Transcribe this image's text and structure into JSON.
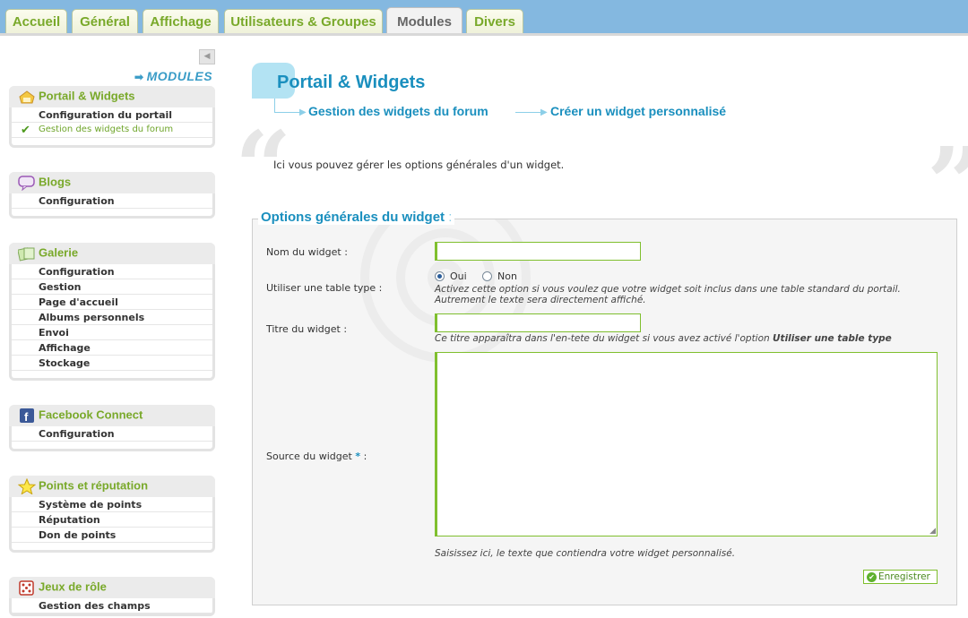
{
  "tabs": [
    {
      "label": "Accueil"
    },
    {
      "label": "Général"
    },
    {
      "label": "Affichage"
    },
    {
      "label": "Utilisateurs & Groupes"
    },
    {
      "label": "Modules"
    },
    {
      "label": "Divers"
    }
  ],
  "sidebar": {
    "heading": "MODULES",
    "boxes": [
      {
        "title": "Portail & Widgets",
        "icon": "portal-icon",
        "items": [
          "Configuration du portail",
          "Gestion des widgets du forum"
        ]
      },
      {
        "title": "Blogs",
        "icon": "speech-bubble-icon",
        "items": [
          "Configuration"
        ]
      },
      {
        "title": "Galerie",
        "icon": "gallery-icon",
        "items": [
          "Configuration",
          "Gestion",
          "Page d'accueil",
          "Albums personnels",
          "Envoi",
          "Affichage",
          "Stockage"
        ]
      },
      {
        "title": "Facebook Connect",
        "icon": "facebook-icon",
        "items": [
          "Configuration"
        ]
      },
      {
        "title": "Points et réputation",
        "icon": "star-icon",
        "items": [
          "Système de points",
          "Réputation",
          "Don de points"
        ]
      },
      {
        "title": "Jeux de rôle",
        "icon": "dice-icon",
        "items": [
          "Gestion des champs"
        ]
      }
    ]
  },
  "main": {
    "title": "Portail & Widgets",
    "breadcrumb": [
      "Gestion des widgets du forum",
      "Créer un widget personnalisé"
    ],
    "intro": "Ici vous pouvez gérer les options générales d'un widget.",
    "legend": "Options générales du widget",
    "legend_colon": ":",
    "fields": {
      "name_label": "Nom du widget :",
      "name_value": "",
      "table_label": "Utiliser une table type :",
      "radio_yes": "Oui",
      "radio_no": "Non",
      "table_help_1": "Activez cette option si vous voulez que votre widget soit inclus dans une table standard du portail.",
      "table_help_2": "Autrement le texte sera directement affiché.",
      "title_label": "Titre du widget :",
      "title_value": "",
      "title_help": "Ce titre apparaîtra dans l'en-tete du widget si vous avez activé l'option",
      "title_help_bold": "Utiliser une table type",
      "source_label": "Source du widget",
      "source_req": "*",
      "source_colon": ":",
      "source_value": "",
      "source_help": "Saisissez ici, le texte que contiendra votre widget personnalisé."
    },
    "save_label": "Enregistrer"
  },
  "colors": {
    "accent_green": "#79a92a",
    "accent_blue": "#1a8fbe",
    "topbar": "#84b8e0"
  }
}
